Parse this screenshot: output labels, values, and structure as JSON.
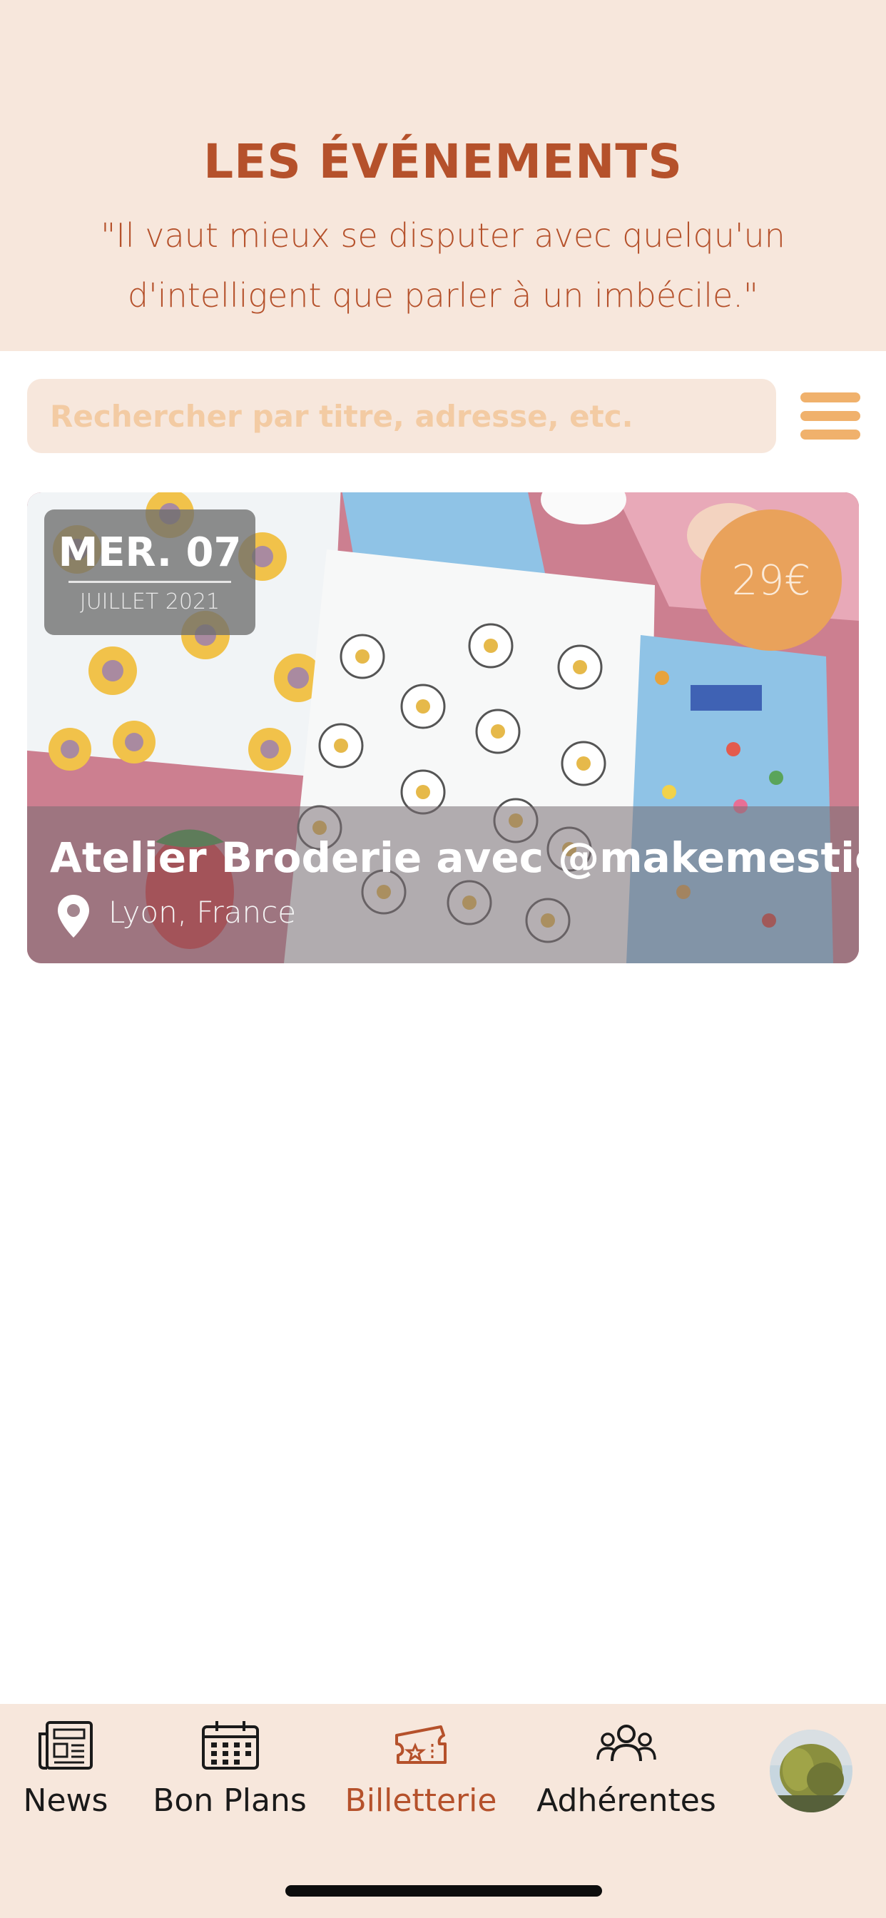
{
  "header": {
    "title": "LES ÉVÉNEMENTS",
    "quote_line1": "\"Il vaut mieux se disputer avec quelqu'un",
    "quote_line2": "d'intelligent que parler à un imbécile.\""
  },
  "search": {
    "placeholder": "Rechercher par titre, adresse, etc."
  },
  "menu": {
    "icon": "hamburger-menu-icon"
  },
  "events": [
    {
      "date_day": "MER. 07",
      "date_month": "JUILLET 2021",
      "price": "29€",
      "title": "Atelier Broderie avec @makemestich",
      "location": "Lyon, France",
      "location_icon": "map-pin-icon",
      "image_subject": "embroidery-pattern-photo"
    }
  ],
  "tabbar": {
    "items": [
      {
        "label": "News",
        "icon": "newspaper-icon"
      },
      {
        "label": "Bon Plans",
        "icon": "calendar-icon"
      },
      {
        "label": "Billetterie",
        "icon": "ticket-icon",
        "active": true
      },
      {
        "label": "Adhérentes",
        "icon": "people-icon"
      }
    ],
    "profile_icon": "profile-avatar"
  },
  "colors": {
    "accent": "#b5512b",
    "header_bg": "#f7e7dc",
    "price_badge": "#e9a25b",
    "menu_icon": "#f0b16c",
    "search_placeholder": "#f3cba3"
  }
}
